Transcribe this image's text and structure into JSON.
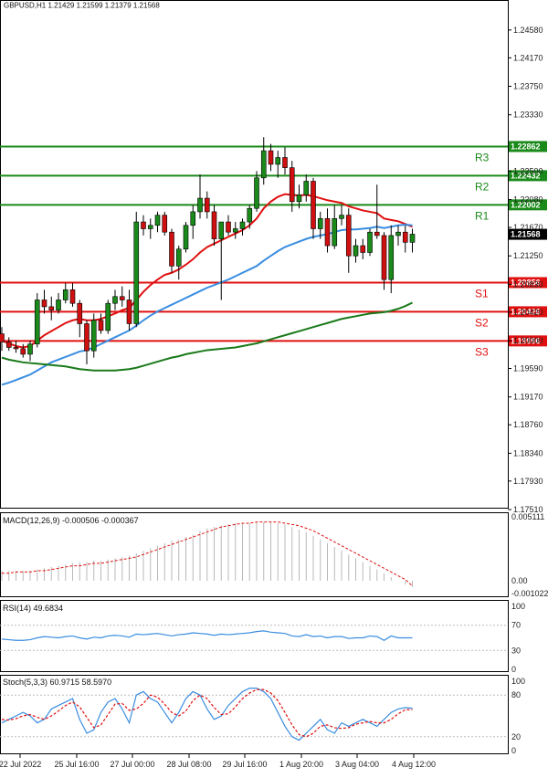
{
  "header": {
    "title": "GBPUSD,H1  1.21429 1.21599 1.21379 1.21568"
  },
  "colors": {
    "resistance": "#1a8a1a",
    "support": "#e01010",
    "bull_candle": "#1a8a1a",
    "bear_candle": "#d01010",
    "ma_fast": "#e01010",
    "ma_mid": "#3a8de0",
    "ma_slow": "#1a7a1a",
    "current_tag_bg": "#000000"
  },
  "time_labels": [
    "22 Jul 2022",
    "25 Jul 16:00",
    "27 Jul 00:00",
    "28 Jul 08:00",
    "29 Jul 16:00",
    "1 Aug 20:00",
    "3 Aug 04:00",
    "4 Aug 12:00"
  ],
  "chart_data": [
    {
      "type": "candlestick",
      "title": "",
      "y_ticks": [
        "1.24580",
        "1.24170",
        "1.23750",
        "1.23330",
        "1.22500",
        "1.22080",
        "1.21670",
        "1.21250",
        "1.20830",
        "1.20420",
        "1.20000",
        "1.19590",
        "1.19170",
        "1.18760",
        "1.18340",
        "1.17930",
        "1.17510"
      ],
      "ylim": [
        1.1751,
        1.2478
      ],
      "current_price": "1.21568",
      "levels": [
        {
          "name": "R3",
          "value": 1.22862,
          "label": "1.22862",
          "kind": "resistance"
        },
        {
          "name": "R2",
          "value": 1.22432,
          "label": "1.22432",
          "kind": "resistance"
        },
        {
          "name": "R1",
          "value": 1.22002,
          "label": "1.22002",
          "kind": "resistance"
        },
        {
          "name": "S1",
          "value": 1.20856,
          "label": "1.20856",
          "kind": "support"
        },
        {
          "name": "S2",
          "value": 1.20426,
          "label": "1.20426",
          "kind": "support"
        },
        {
          "name": "S3",
          "value": 1.19996,
          "label": "1.19996",
          "kind": "support"
        }
      ],
      "candles": [
        [
          1.201,
          1.202,
          1.1985,
          1.1998
        ],
        [
          1.1998,
          1.2005,
          1.1985,
          1.199
        ],
        [
          1.199,
          1.2,
          1.1982,
          1.1988
        ],
        [
          1.1988,
          1.1995,
          1.1975,
          1.198
        ],
        [
          1.198,
          1.2,
          1.197,
          1.1995
        ],
        [
          1.1995,
          1.207,
          1.199,
          1.206
        ],
        [
          1.206,
          1.2075,
          1.204,
          1.205
        ],
        [
          1.205,
          1.2065,
          1.203,
          1.2045
        ],
        [
          1.2045,
          1.207,
          1.204,
          1.206
        ],
        [
          1.206,
          1.2085,
          1.2055,
          1.2075
        ],
        [
          1.2075,
          1.2085,
          1.205,
          1.2055
        ],
        [
          1.2055,
          1.206,
          1.2005,
          1.2025
        ],
        [
          1.2025,
          1.203,
          1.1965,
          1.1985
        ],
        [
          1.1985,
          1.204,
          1.1975,
          1.203
        ],
        [
          1.203,
          1.204,
          1.201,
          1.2015
        ],
        [
          1.2015,
          1.206,
          1.201,
          1.2055
        ],
        [
          1.2055,
          1.2075,
          1.2045,
          1.2065
        ],
        [
          1.2065,
          1.208,
          1.205,
          1.206
        ],
        [
          1.206,
          1.2075,
          1.2015,
          1.2025
        ],
        [
          1.2025,
          1.219,
          1.202,
          1.2175
        ],
        [
          1.2175,
          1.2185,
          1.2155,
          1.2165
        ],
        [
          1.2165,
          1.218,
          1.215,
          1.217
        ],
        [
          1.217,
          1.219,
          1.216,
          1.2185
        ],
        [
          1.2185,
          1.219,
          1.2155,
          1.216
        ],
        [
          1.216,
          1.2165,
          1.21,
          1.211
        ],
        [
          1.211,
          1.214,
          1.209,
          1.2135
        ],
        [
          1.2135,
          1.2175,
          1.213,
          1.217
        ],
        [
          1.217,
          1.22,
          1.215,
          1.219
        ],
        [
          1.219,
          1.2245,
          1.218,
          1.221
        ],
        [
          1.221,
          1.222,
          1.218,
          1.219
        ],
        [
          1.219,
          1.22,
          1.214,
          1.215
        ],
        [
          1.215,
          1.2165,
          1.206,
          1.2175
        ],
        [
          1.2175,
          1.2185,
          1.2155,
          1.216
        ],
        [
          1.216,
          1.2175,
          1.215,
          1.2165
        ],
        [
          1.2165,
          1.218,
          1.2155,
          1.2175
        ],
        [
          1.2175,
          1.22,
          1.2165,
          1.2195
        ],
        [
          1.2195,
          1.225,
          1.219,
          1.224
        ],
        [
          1.224,
          1.23,
          1.223,
          1.228
        ],
        [
          1.228,
          1.229,
          1.225,
          1.226
        ],
        [
          1.226,
          1.228,
          1.224,
          1.227
        ],
        [
          1.227,
          1.2285,
          1.2245,
          1.2255
        ],
        [
          1.2255,
          1.2265,
          1.219,
          1.2205
        ],
        [
          1.2205,
          1.223,
          1.2195,
          1.2215
        ],
        [
          1.2215,
          1.2245,
          1.2205,
          1.2235
        ],
        [
          1.2235,
          1.224,
          1.215,
          1.2165
        ],
        [
          1.2165,
          1.219,
          1.215,
          1.218
        ],
        [
          1.218,
          1.2195,
          1.213,
          1.214
        ],
        [
          1.214,
          1.22,
          1.2135,
          1.218
        ],
        [
          1.218,
          1.22,
          1.217,
          1.2185
        ],
        [
          1.2185,
          1.2195,
          1.21,
          1.2125
        ],
        [
          1.2125,
          1.215,
          1.2115,
          1.214
        ],
        [
          1.214,
          1.215,
          1.212,
          1.213
        ],
        [
          1.213,
          1.2165,
          1.2125,
          1.216
        ],
        [
          1.216,
          1.223,
          1.215,
          1.2155
        ],
        [
          1.2155,
          1.216,
          1.2075,
          1.209
        ],
        [
          1.209,
          1.217,
          1.207,
          1.2155
        ],
        [
          1.2155,
          1.217,
          1.214,
          1.216
        ],
        [
          1.216,
          1.217,
          1.213,
          1.2145
        ],
        [
          1.2145,
          1.2165,
          1.213,
          1.2157
        ]
      ],
      "series": [
        {
          "name": "",
          "color": "#e01010",
          "values": [
            1.2,
            1.1996,
            1.1992,
            1.199,
            1.1992,
            1.2,
            1.2008,
            1.2014,
            1.202,
            1.2026,
            1.203,
            1.2032,
            1.203,
            1.203,
            1.2032,
            1.2036,
            1.204,
            1.2045,
            1.2048,
            1.206,
            1.2072,
            1.2082,
            1.209,
            1.2097,
            1.21,
            1.2105,
            1.2112,
            1.212,
            1.213,
            1.2138,
            1.2143,
            1.2148,
            1.2153,
            1.2158,
            1.2163,
            1.217,
            1.218,
            1.2195,
            1.2205,
            1.2212,
            1.2216,
            1.2215,
            1.2214,
            1.2215,
            1.2213,
            1.221,
            1.2207,
            1.2205,
            1.2203,
            1.2198,
            1.2195,
            1.2192,
            1.219,
            1.2188,
            1.218,
            1.2178,
            1.2176,
            1.2172,
            1.2168
          ]
        },
        {
          "name": "",
          "color": "#3a8de0",
          "values": [
            1.1935,
            1.1938,
            1.1942,
            1.1946,
            1.195,
            1.1956,
            1.1962,
            1.1968,
            1.1972,
            1.1976,
            1.198,
            1.1984,
            1.1986,
            1.199,
            1.1995,
            1.2,
            1.2005,
            1.201,
            1.2015,
            1.2022,
            1.203,
            1.2037,
            1.2043,
            1.2048,
            1.2053,
            1.2058,
            1.2063,
            1.2068,
            1.2073,
            1.2078,
            1.2082,
            1.2086,
            1.209,
            1.2095,
            1.21,
            1.2105,
            1.211,
            1.2118,
            1.2125,
            1.2132,
            1.2138,
            1.2142,
            1.2146,
            1.215,
            1.2153,
            1.2155,
            1.2157,
            1.216,
            1.2163,
            1.2164,
            1.2164,
            1.2165,
            1.2166,
            1.2168,
            1.2166,
            1.2168,
            1.217,
            1.2171,
            1.217
          ]
        },
        {
          "name": "",
          "color": "#1a7a1a",
          "values": [
            1.1975,
            1.1972,
            1.197,
            1.1968,
            1.1967,
            1.1966,
            1.1965,
            1.1964,
            1.1963,
            1.1962,
            1.196,
            1.1958,
            1.1957,
            1.1956,
            1.1956,
            1.1956,
            1.1956,
            1.1957,
            1.1958,
            1.196,
            1.1963,
            1.1966,
            1.1969,
            1.1972,
            1.1975,
            1.1977,
            1.198,
            1.1982,
            1.1984,
            1.1986,
            1.1987,
            1.1988,
            1.1989,
            1.199,
            1.1992,
            1.1994,
            1.1996,
            1.1999,
            1.2002,
            1.2005,
            1.2008,
            1.2011,
            1.2014,
            1.2017,
            1.202,
            1.2023,
            1.2026,
            1.2029,
            1.2032,
            1.2034,
            1.2036,
            1.2038,
            1.204,
            1.2041,
            1.2042,
            1.2044,
            1.2047,
            1.2051,
            1.2056
          ]
        }
      ]
    },
    {
      "type": "bar",
      "title": "MACD(12,26,9) -0.000506 -0.000367",
      "y_ticks": [
        "0.005111",
        "0.00",
        "-0.001022"
      ],
      "ylim": [
        -0.001022,
        0.005111
      ],
      "values": [
        0.0008,
        0.0008,
        0.0008,
        0.0008,
        0.0008,
        0.0009,
        0.001,
        0.0011,
        0.0012,
        0.0013,
        0.0014,
        0.0015,
        0.0015,
        0.0016,
        0.0016,
        0.0017,
        0.0018,
        0.0019,
        0.002,
        0.0022,
        0.0024,
        0.0026,
        0.0028,
        0.003,
        0.0032,
        0.0033,
        0.0035,
        0.0037,
        0.004,
        0.0042,
        0.0043,
        0.0044,
        0.0045,
        0.0046,
        0.0046,
        0.0046,
        0.0047,
        0.0047,
        0.0047,
        0.0046,
        0.0045,
        0.0043,
        0.0041,
        0.0039,
        0.0036,
        0.0033,
        0.003,
        0.0027,
        0.0024,
        0.0021,
        0.0018,
        0.0015,
        0.0012,
        0.0009,
        0.0006,
        0.0003,
        0.0,
        -0.0003,
        -0.0005
      ],
      "signal": [
        0.0006,
        0.0006,
        0.0007,
        0.0007,
        0.0007,
        0.0008,
        0.0008,
        0.0009,
        0.001,
        0.0011,
        0.0012,
        0.0012,
        0.0013,
        0.0014,
        0.0014,
        0.0015,
        0.0016,
        0.0017,
        0.0018,
        0.0019,
        0.0021,
        0.0023,
        0.0025,
        0.0027,
        0.0029,
        0.0031,
        0.0033,
        0.0035,
        0.0037,
        0.0039,
        0.0041,
        0.0043,
        0.0044,
        0.0045,
        0.0046,
        0.0046,
        0.0047,
        0.0047,
        0.0047,
        0.0047,
        0.0046,
        0.0045,
        0.0044,
        0.0042,
        0.004,
        0.0037,
        0.0034,
        0.0031,
        0.0028,
        0.0025,
        0.0022,
        0.0019,
        0.0016,
        0.0013,
        0.001,
        0.0007,
        0.0004,
        0.0001,
        -0.0004
      ],
      "colors": {
        "histogram": "#b8b8b8",
        "signal": "#e01010"
      }
    },
    {
      "type": "line",
      "title": "RSI(14) 49.6834",
      "y_ticks": [
        "100",
        "70",
        "30",
        "0"
      ],
      "ylim": [
        0,
        100
      ],
      "series": [
        {
          "name": "",
          "color": "#3a8de0",
          "values": [
            48,
            47,
            46,
            46,
            47,
            50,
            52,
            51,
            50,
            52,
            53,
            50,
            48,
            51,
            50,
            53,
            54,
            53,
            51,
            56,
            55,
            56,
            57,
            55,
            53,
            55,
            56,
            58,
            57,
            56,
            54,
            56,
            55,
            56,
            57,
            58,
            60,
            61,
            59,
            58,
            57,
            53,
            52,
            55,
            52,
            53,
            50,
            52,
            52,
            49,
            50,
            50,
            53,
            52,
            46,
            53,
            50,
            50,
            50
          ]
        }
      ]
    },
    {
      "type": "line",
      "title": "Stoch(5,3,3) 60.9715 58.5970",
      "y_ticks": [
        "100",
        "80",
        "20",
        "0"
      ],
      "ylim": [
        0,
        100
      ],
      "series": [
        {
          "name": "",
          "color": "#3a8de0",
          "values": [
            40,
            45,
            50,
            55,
            50,
            40,
            45,
            60,
            65,
            70,
            75,
            45,
            25,
            30,
            55,
            70,
            75,
            60,
            40,
            80,
            85,
            75,
            70,
            55,
            40,
            55,
            75,
            85,
            80,
            60,
            45,
            50,
            65,
            75,
            85,
            90,
            90,
            85,
            75,
            55,
            35,
            20,
            15,
            25,
            35,
            45,
            30,
            25,
            40,
            35,
            40,
            45,
            40,
            35,
            45,
            55,
            60,
            62,
            61
          ]
        },
        {
          "name": "",
          "color": "#e01010",
          "values": [
            45,
            44,
            46,
            50,
            52,
            48,
            45,
            50,
            57,
            65,
            70,
            63,
            48,
            33,
            37,
            52,
            67,
            68,
            58,
            60,
            68,
            80,
            77,
            67,
            55,
            50,
            57,
            72,
            80,
            75,
            62,
            52,
            53,
            63,
            75,
            83,
            88,
            88,
            83,
            72,
            55,
            37,
            23,
            20,
            25,
            35,
            37,
            33,
            32,
            33,
            38,
            40,
            42,
            40,
            40,
            45,
            53,
            59,
            59
          ]
        }
      ]
    }
  ]
}
